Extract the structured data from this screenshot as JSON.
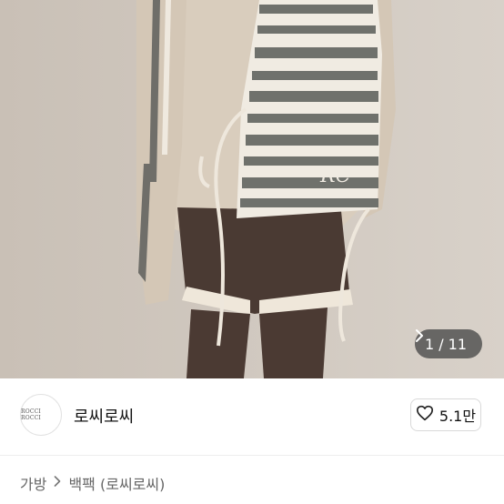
{
  "product_image": {
    "counter": "1 / 11",
    "next_icon": "chevron-right-icon"
  },
  "store": {
    "logo_text": "ROCCI ROCCI",
    "name": "로씨로씨"
  },
  "like": {
    "icon": "heart-outline-icon",
    "count": "5.1만"
  },
  "breadcrumb": {
    "items": [
      "가방",
      "백팩 (로씨로씨)"
    ],
    "separator_icon": "chevron-right-icon"
  },
  "colors": {
    "counter_bg": "#484848",
    "text": "#111111",
    "muted": "#666666",
    "border": "#d9d9d9"
  }
}
